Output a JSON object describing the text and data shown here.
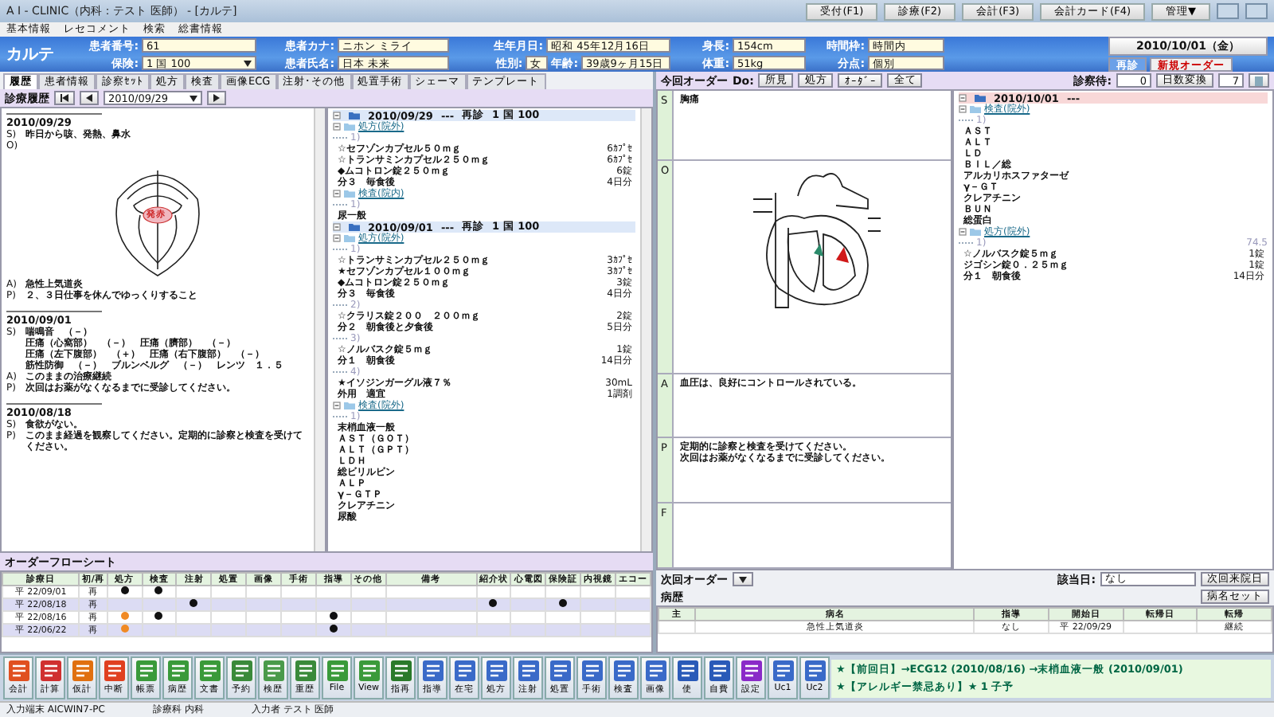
{
  "window": {
    "title": "A I - CLINIC（内科：テスト 医師） - [カルテ]"
  },
  "nav_buttons": [
    "受付(F1)",
    "診療(F2)",
    "会計(F3)",
    "会計カード(F4)",
    "管理▼"
  ],
  "menu": [
    "基本情報",
    "レセコメント",
    "検索",
    "総書情報"
  ],
  "header": {
    "logo": "カルテ",
    "rows": [
      [
        {
          "parts": [
            {
              "label": "患者番号:",
              "value": "61",
              "kind": "text"
            }
          ]
        },
        {
          "parts": [
            {
              "label": "患者カナ:",
              "value": "ニホン ミライ",
              "kind": "text"
            }
          ]
        },
        {
          "parts": [
            {
              "label": "生年月日:",
              "value": "昭和 45年12月16日",
              "kind": "text"
            }
          ]
        },
        {
          "parts": [
            {
              "label": "身長:",
              "value": "154cm",
              "kind": "text"
            }
          ]
        },
        {
          "parts": [
            {
              "label": "時間枠:",
              "value": "時間内",
              "kind": "text"
            }
          ]
        }
      ],
      [
        {
          "parts": [
            {
              "label": "保険:",
              "value": "1 国 100",
              "kind": "select"
            }
          ]
        },
        {
          "parts": [
            {
              "label": "患者氏名:",
              "value": "日本 未来",
              "kind": "text"
            }
          ]
        },
        {
          "parts": [
            {
              "label": "性別:",
              "value": "女",
              "kind": "text"
            },
            {
              "label": "年齢:",
              "value": "39歳9ヶ月15日",
              "kind": "text"
            }
          ]
        },
        {
          "parts": [
            {
              "label": "体重:",
              "value": "51kg",
              "kind": "text"
            }
          ]
        },
        {
          "parts": [
            {
              "label": "分点:",
              "value": "個別",
              "kind": "text"
            }
          ]
        }
      ]
    ],
    "date": "2010/10/01（金）",
    "visit_buttons": [
      {
        "label": "再診",
        "selected": true
      },
      {
        "label": "新規オーダー",
        "selected": false
      }
    ]
  },
  "tabs": [
    {
      "label": "履歴",
      "selected": true
    },
    {
      "label": "患者情報",
      "selected": false
    },
    {
      "label": "診察ｾｯﾄ",
      "selected": false
    },
    {
      "label": "処方",
      "selected": false
    },
    {
      "label": "検査",
      "selected": false
    },
    {
      "label": "画像ECG",
      "selected": false
    },
    {
      "label": "注射･その他",
      "selected": false
    },
    {
      "label": "処置手術",
      "selected": false
    },
    {
      "label": "シェーマ",
      "selected": false
    },
    {
      "label": "テンプレート",
      "selected": false
    }
  ],
  "history": {
    "title": "診療履歴",
    "date": "2010/09/29",
    "entries": [
      {
        "date": "2010/09/29",
        "lines": [
          {
            "tag": "S)",
            "text": "昨日から咳、発熱、鼻水"
          },
          {
            "tag": "O)",
            "kind": "drawing",
            "annotation": "発赤"
          },
          {
            "tag": "A)",
            "text": "急性上気道炎"
          },
          {
            "tag": "P)",
            "text": "２、３日仕事を休んでゆっくりすること"
          }
        ]
      },
      {
        "date": "2010/09/01",
        "lines": [
          {
            "tag": "S)",
            "text": "喘鳴音　（－）"
          },
          {
            "text": "圧痛（心窩部）　（－）　圧痛（臍部）　（－）"
          },
          {
            "text": "圧痛（左下腹部）　（＋）　圧痛（右下腹部）　（－）"
          },
          {
            "text": "筋性防御　（－）　ブルンベルグ　（－）　レンツ　１．５"
          },
          {
            "tag": "A)",
            "text": "このままの治療継続"
          },
          {
            "tag": "P)",
            "text": "次回はお薬がなくなるまでに受診してください。"
          }
        ]
      },
      {
        "date": "2010/08/18",
        "lines": [
          {
            "tag": "S)",
            "text": "食欲がない。"
          },
          {
            "tag": "P)",
            "text": "このまま経過を観察してください。定期的に診察と検査を受けてください。"
          }
        ]
      }
    ]
  },
  "order_tree": [
    {
      "date": "2010/09/29",
      "dashes": "---",
      "visit": "再診",
      "insurance": "1 国 100",
      "groups": [
        {
          "label": "処方(院外)",
          "rps": [
            {
              "num": "1)",
              "items": [
                {
                  "name": "☆セフゾンカプセル５０ｍｇ",
                  "qty": "6ｶﾌﾟｾ"
                },
                {
                  "name": "☆トランサミンカプセル２５０ｍｇ",
                  "qty": "6ｶﾌﾟｾ"
                },
                {
                  "name": "◆ムコトロン錠２５０ｍｇ",
                  "qty": "6錠"
                },
                {
                  "name": "分３　毎食後",
                  "qty": "4日分"
                }
              ]
            }
          ]
        },
        {
          "label": "検査(院内)",
          "rps": [
            {
              "num": "1)",
              "items": [
                {
                  "name": "尿一般"
                }
              ]
            }
          ]
        }
      ]
    },
    {
      "date": "2010/09/01",
      "dashes": "---",
      "visit": "再診",
      "insurance": "1 国 100",
      "groups": [
        {
          "label": "処方(院外)",
          "rps": [
            {
              "num": "1)",
              "items": [
                {
                  "name": "☆トランサミンカプセル２５０ｍｇ",
                  "qty": "3ｶﾌﾟｾ"
                },
                {
                  "name": "★セフゾンカプセル１００ｍｇ",
                  "qty": "3ｶﾌﾟｾ"
                },
                {
                  "name": "◆ムコトロン錠２５０ｍｇ",
                  "qty": "3錠"
                },
                {
                  "name": "分３　毎食後",
                  "qty": "4日分"
                }
              ]
            },
            {
              "num": "2)",
              "items": [
                {
                  "name": "☆クラリス錠２００　２００ｍｇ",
                  "qty": "2錠"
                },
                {
                  "name": "分２　朝食後と夕食後",
                  "qty": "5日分"
                }
              ]
            },
            {
              "num": "3)",
              "items": [
                {
                  "name": "☆ノルバスク錠５ｍｇ",
                  "qty": "1錠"
                },
                {
                  "name": "分１　朝食後",
                  "qty": "14日分"
                }
              ]
            },
            {
              "num": "4)",
              "items": [
                {
                  "name": "★イソジンガーグル液７％",
                  "qty": "30mL"
                },
                {
                  "name": "外用　適宜",
                  "qty": "1調剤"
                }
              ]
            }
          ]
        },
        {
          "label": "検査(院外)",
          "rps": [
            {
              "num": "1)",
              "items": [
                {
                  "name": "末梢血液一般"
                },
                {
                  "name": "ＡＳＴ（ＧＯＴ）"
                },
                {
                  "name": "ＡＬＴ（ＧＰＴ）"
                },
                {
                  "name": "ＬＤＨ"
                },
                {
                  "name": "総ビリルビン"
                },
                {
                  "name": "ＡＬＰ"
                },
                {
                  "name": "γ－ＧＴＰ"
                },
                {
                  "name": "クレアチニン"
                },
                {
                  "name": "尿酸"
                }
              ]
            }
          ]
        }
      ]
    }
  ],
  "order_toolbar": {
    "title": "今回オーダー",
    "do_label": "Do:",
    "buttons": [
      "所見",
      "処方",
      "ｵｰﾀﾞｰ",
      "全て"
    ],
    "wait_label": "診察待:",
    "wait_value": "0",
    "convert_button": "日数変換",
    "days": "7"
  },
  "soap": [
    {
      "letter": "S",
      "lines": [
        "胸痛"
      ]
    },
    {
      "letter": "O",
      "kind": "drawing"
    },
    {
      "letter": "A",
      "lines": [
        "血圧は、良好にコントロールされている。"
      ]
    },
    {
      "letter": "P",
      "lines": [
        "定期的に診察と検査を受けてください。",
        "次回はお薬がなくなるまでに受診してください。"
      ]
    },
    {
      "letter": "F"
    }
  ],
  "current_tree": {
    "date": "2010/10/01",
    "dashes": "---",
    "groups": [
      {
        "label": "検査(院外)",
        "rps": [
          {
            "num": "1)",
            "items": [
              {
                "name": "ＡＳＴ"
              },
              {
                "name": "ＡＬＴ"
              },
              {
                "name": "ＬＤ"
              },
              {
                "name": "ＢＩＬ／総"
              },
              {
                "name": "アルカリホスファターゼ"
              },
              {
                "name": "γ－ＧＴ"
              },
              {
                "name": "クレアチニン"
              },
              {
                "name": "ＢＵＮ"
              },
              {
                "name": "総蛋白"
              }
            ]
          }
        ]
      },
      {
        "label": "処方(院外)",
        "rps": [
          {
            "num": "1)",
            "note": "74.5",
            "items": [
              {
                "name": "☆ノルバスク錠５ｍｇ",
                "qty": "1錠"
              },
              {
                "name": "ジゴシン錠０．２５ｍｇ",
                "qty": "1錠"
              },
              {
                "name": "分１　朝食後",
                "qty": "14日分"
              }
            ]
          }
        ]
      }
    ]
  },
  "flowsheet": {
    "title": "オーダーフローシート",
    "columns": [
      "診療日",
      "初/再",
      "処方",
      "検査",
      "注射",
      "処置",
      "画像",
      "手術",
      "指導",
      "その他",
      "備考",
      "紹介状",
      "心電図",
      "保険証",
      "内視鏡",
      "エコー"
    ],
    "rows": [
      {
        "date": "平 22/09/01",
        "visit": "再",
        "cells": [
          {
            "dot": true,
            "color": "#111111"
          },
          {
            "dot": true,
            "color": "#111111"
          },
          {
            "dot": false
          },
          {
            "dot": false
          },
          {
            "dot": false
          },
          {
            "dot": false
          },
          {
            "dot": false
          },
          {
            "dot": false
          },
          {
            "dot": false
          },
          {
            "dot": false
          },
          {
            "dot": false
          },
          {
            "dot": false
          },
          {
            "dot": false
          },
          {
            "dot": false
          }
        ]
      },
      {
        "date": "平 22/08/18",
        "visit": "再",
        "cells": [
          {
            "dot": false
          },
          {
            "dot": false
          },
          {
            "dot": true,
            "color": "#111111"
          },
          {
            "dot": false
          },
          {
            "dot": false
          },
          {
            "dot": false
          },
          {
            "dot": false
          },
          {
            "dot": false
          },
          {
            "dot": false
          },
          {
            "dot": true,
            "color": "#111111"
          },
          {
            "dot": false
          },
          {
            "dot": true,
            "color": "#111111"
          },
          {
            "dot": false
          },
          {
            "dot": false
          }
        ]
      },
      {
        "date": "平 22/08/16",
        "visit": "再",
        "cells": [
          {
            "dot": true,
            "color": "#f08a24"
          },
          {
            "dot": true,
            "color": "#111111"
          },
          {
            "dot": false
          },
          {
            "dot": false
          },
          {
            "dot": false
          },
          {
            "dot": false
          },
          {
            "dot": true,
            "color": "#111111"
          },
          {
            "dot": false
          },
          {
            "dot": false
          },
          {
            "dot": false
          },
          {
            "dot": false
          },
          {
            "dot": false
          },
          {
            "dot": false
          },
          {
            "dot": false
          }
        ]
      },
      {
        "date": "平 22/06/22",
        "visit": "再",
        "cells": [
          {
            "dot": true,
            "color": "#f08a24"
          },
          {
            "dot": false
          },
          {
            "dot": false
          },
          {
            "dot": false
          },
          {
            "dot": false
          },
          {
            "dot": false
          },
          {
            "dot": true,
            "color": "#111111"
          },
          {
            "dot": false
          },
          {
            "dot": false
          },
          {
            "dot": false
          },
          {
            "dot": false
          },
          {
            "dot": false
          },
          {
            "dot": false
          },
          {
            "dot": false
          }
        ]
      }
    ]
  },
  "next_order": {
    "title": "次回オーダー",
    "date_label": "該当日:",
    "date_value": "なし",
    "button": "次回来院日"
  },
  "disease": {
    "title": "病歴",
    "button": "病名セット",
    "columns": [
      "主",
      "病名",
      "指導",
      "開始日",
      "転帰日",
      "転帰"
    ],
    "rows": [
      [
        null,
        "急性上気道炎",
        "なし",
        "平 22/09/29",
        null,
        "継続"
      ]
    ]
  },
  "toolbar": [
    "会計",
    "計算",
    "仮計",
    "中断",
    "帳票",
    "病歴",
    "文書",
    "予約",
    "検歴",
    "重歴",
    "File",
    "View",
    "指再",
    "指導",
    "在宅",
    "処方",
    "注射",
    "処置",
    "手術",
    "検査",
    "画像",
    "使",
    "自費",
    "設定",
    "Uc1",
    "Uc2"
  ],
  "status": {
    "fields": [
      "入力端末 AICWIN7-PC",
      "診療科 内科",
      "入力者 テスト 医師"
    ],
    "alerts": [
      "★【前回日】→ECG12 (2010/08/16) →末梢血液一般 (2010/09/01)",
      "★【アレルギー禁忌あり】★ 1 子予"
    ]
  }
}
